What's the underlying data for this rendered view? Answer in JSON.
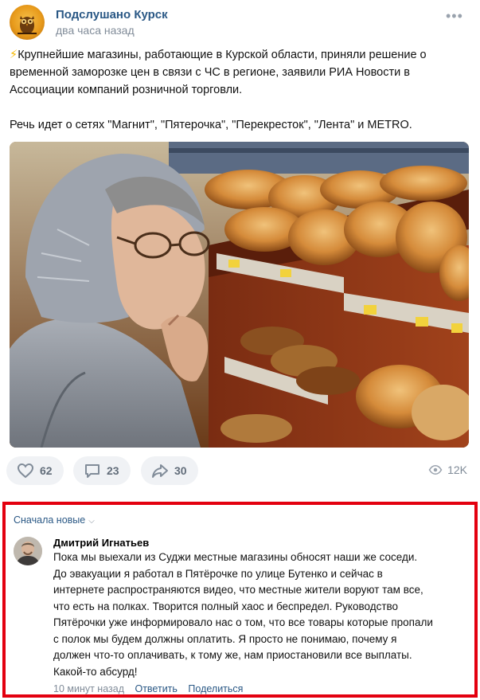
{
  "post": {
    "community_name": "Подслушано Курск",
    "time": "два часа назад",
    "more_icon": "more-horizontal-icon",
    "text_lines": [
      "⚡Крупнейшие магазины, работающие в Курской области, приняли решение о",
      "временной заморозке цен в связи с ЧС в регионе, заявили РИА Новости в",
      "Ассоциации компаний розничной торговли.",
      "Речь идет о сетях \"Магнит\", \"Пятерочка\", \"Перекресток\", \"Лента\" и METRO."
    ],
    "photo_icon": "photo-elderly-woman-bread-shelves"
  },
  "actions": {
    "likes": "62",
    "comments": "23",
    "shares": "30",
    "views": "12K",
    "like_icon": "heart-icon",
    "comment_icon": "comment-icon",
    "share_icon": "share-arrow-icon",
    "views_icon": "eye-icon"
  },
  "comments": {
    "sort_label": "Сначала новые",
    "sort_icon": "chevron-down-icon",
    "frame_color": "#e3000f",
    "items": [
      {
        "author": "Дмитрий Игнатьев",
        "lines": [
          "Пока мы выехали из Суджи местные магазины обносят наши же соседи.",
          "До эвакуации я работал в Пятёрочке по улице Бутенко и сейчас в",
          "интернете распространяются видео, что местные жители воруют там все,",
          "что есть на полках. Творится полный хаос и беспредел. Руководство",
          "Пятёрочки уже информировало нас о том, что все товары которые пропали",
          "с полок мы будем должны оплатить. Я просто не понимаю, почему я",
          "должен что-то оплачивать, к тому же, нам приостановили все выплаты.",
          "Какой-то абсурд!"
        ],
        "time": "10 минут назад",
        "reply_label": "Ответить",
        "share_label": "Поделиться"
      }
    ]
  },
  "colors": {
    "link": "#2a5885",
    "muted": "#818c99",
    "button_bg": "#f0f2f5"
  }
}
